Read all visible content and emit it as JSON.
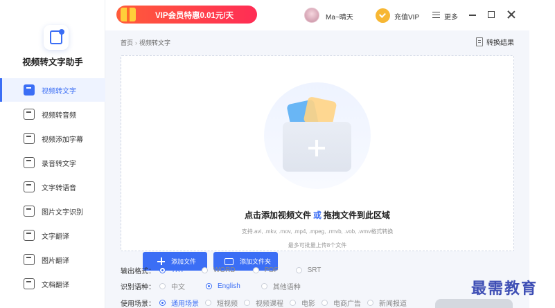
{
  "app": {
    "name": "视频转文字助手"
  },
  "sidebar": {
    "items": [
      {
        "label": "视频转文字",
        "icon": "video-to-text-icon",
        "active": true
      },
      {
        "label": "视频转音频",
        "icon": "video-to-audio-icon",
        "active": false
      },
      {
        "label": "视频添加字幕",
        "icon": "video-subtitle-icon",
        "active": false
      },
      {
        "label": "录音转文字",
        "icon": "audio-to-text-icon",
        "active": false
      },
      {
        "label": "文字转语音",
        "icon": "text-to-speech-icon",
        "active": false
      },
      {
        "label": "图片文字识别",
        "icon": "image-ocr-icon",
        "active": false
      },
      {
        "label": "文字翻译",
        "icon": "text-translate-icon",
        "active": false
      },
      {
        "label": "图片翻译",
        "icon": "image-translate-icon",
        "active": false
      },
      {
        "label": "文档翻译",
        "icon": "doc-translate-icon",
        "active": false
      }
    ]
  },
  "topbar": {
    "promo": "VIP会员特惠0.01元/天",
    "user_name": "Ma~晴天",
    "vip_label": "充值VIP",
    "more_label": "更多"
  },
  "breadcrumb": {
    "home": "首页",
    "sep": "›",
    "current": "视频转文字"
  },
  "result_label": "转换结果",
  "dropzone": {
    "title_a": "点击添加视频文件",
    "title_or": "或",
    "title_b": "拖拽文件到此区域",
    "formats": "支持.avi, .mkv, .mov, .mp4, .mpeg, .rmvb, .vob, .wmv格式转换",
    "limit": "最多可批量上传8个文件",
    "add_file": "添加文件",
    "add_folder": "添加文件夹"
  },
  "options": {
    "output_format": {
      "label": "输出格式：",
      "choices": [
        "TXT",
        "WORD",
        "PDF",
        "SRT"
      ],
      "selected": "TXT"
    },
    "language": {
      "label": "识别语种：",
      "choices": [
        "中文",
        "English",
        "其他语种"
      ],
      "selected": "English"
    },
    "scene": {
      "label": "使用场景：",
      "choices": [
        "通用场景",
        "短视频",
        "视频课程",
        "电影",
        "电商广告",
        "新闻报道"
      ],
      "selected": "通用场景"
    }
  },
  "colors": {
    "accent": "#3b6ef5",
    "promo": "#ff2d55",
    "vip": "#f7b733"
  },
  "watermark": "最需教育"
}
